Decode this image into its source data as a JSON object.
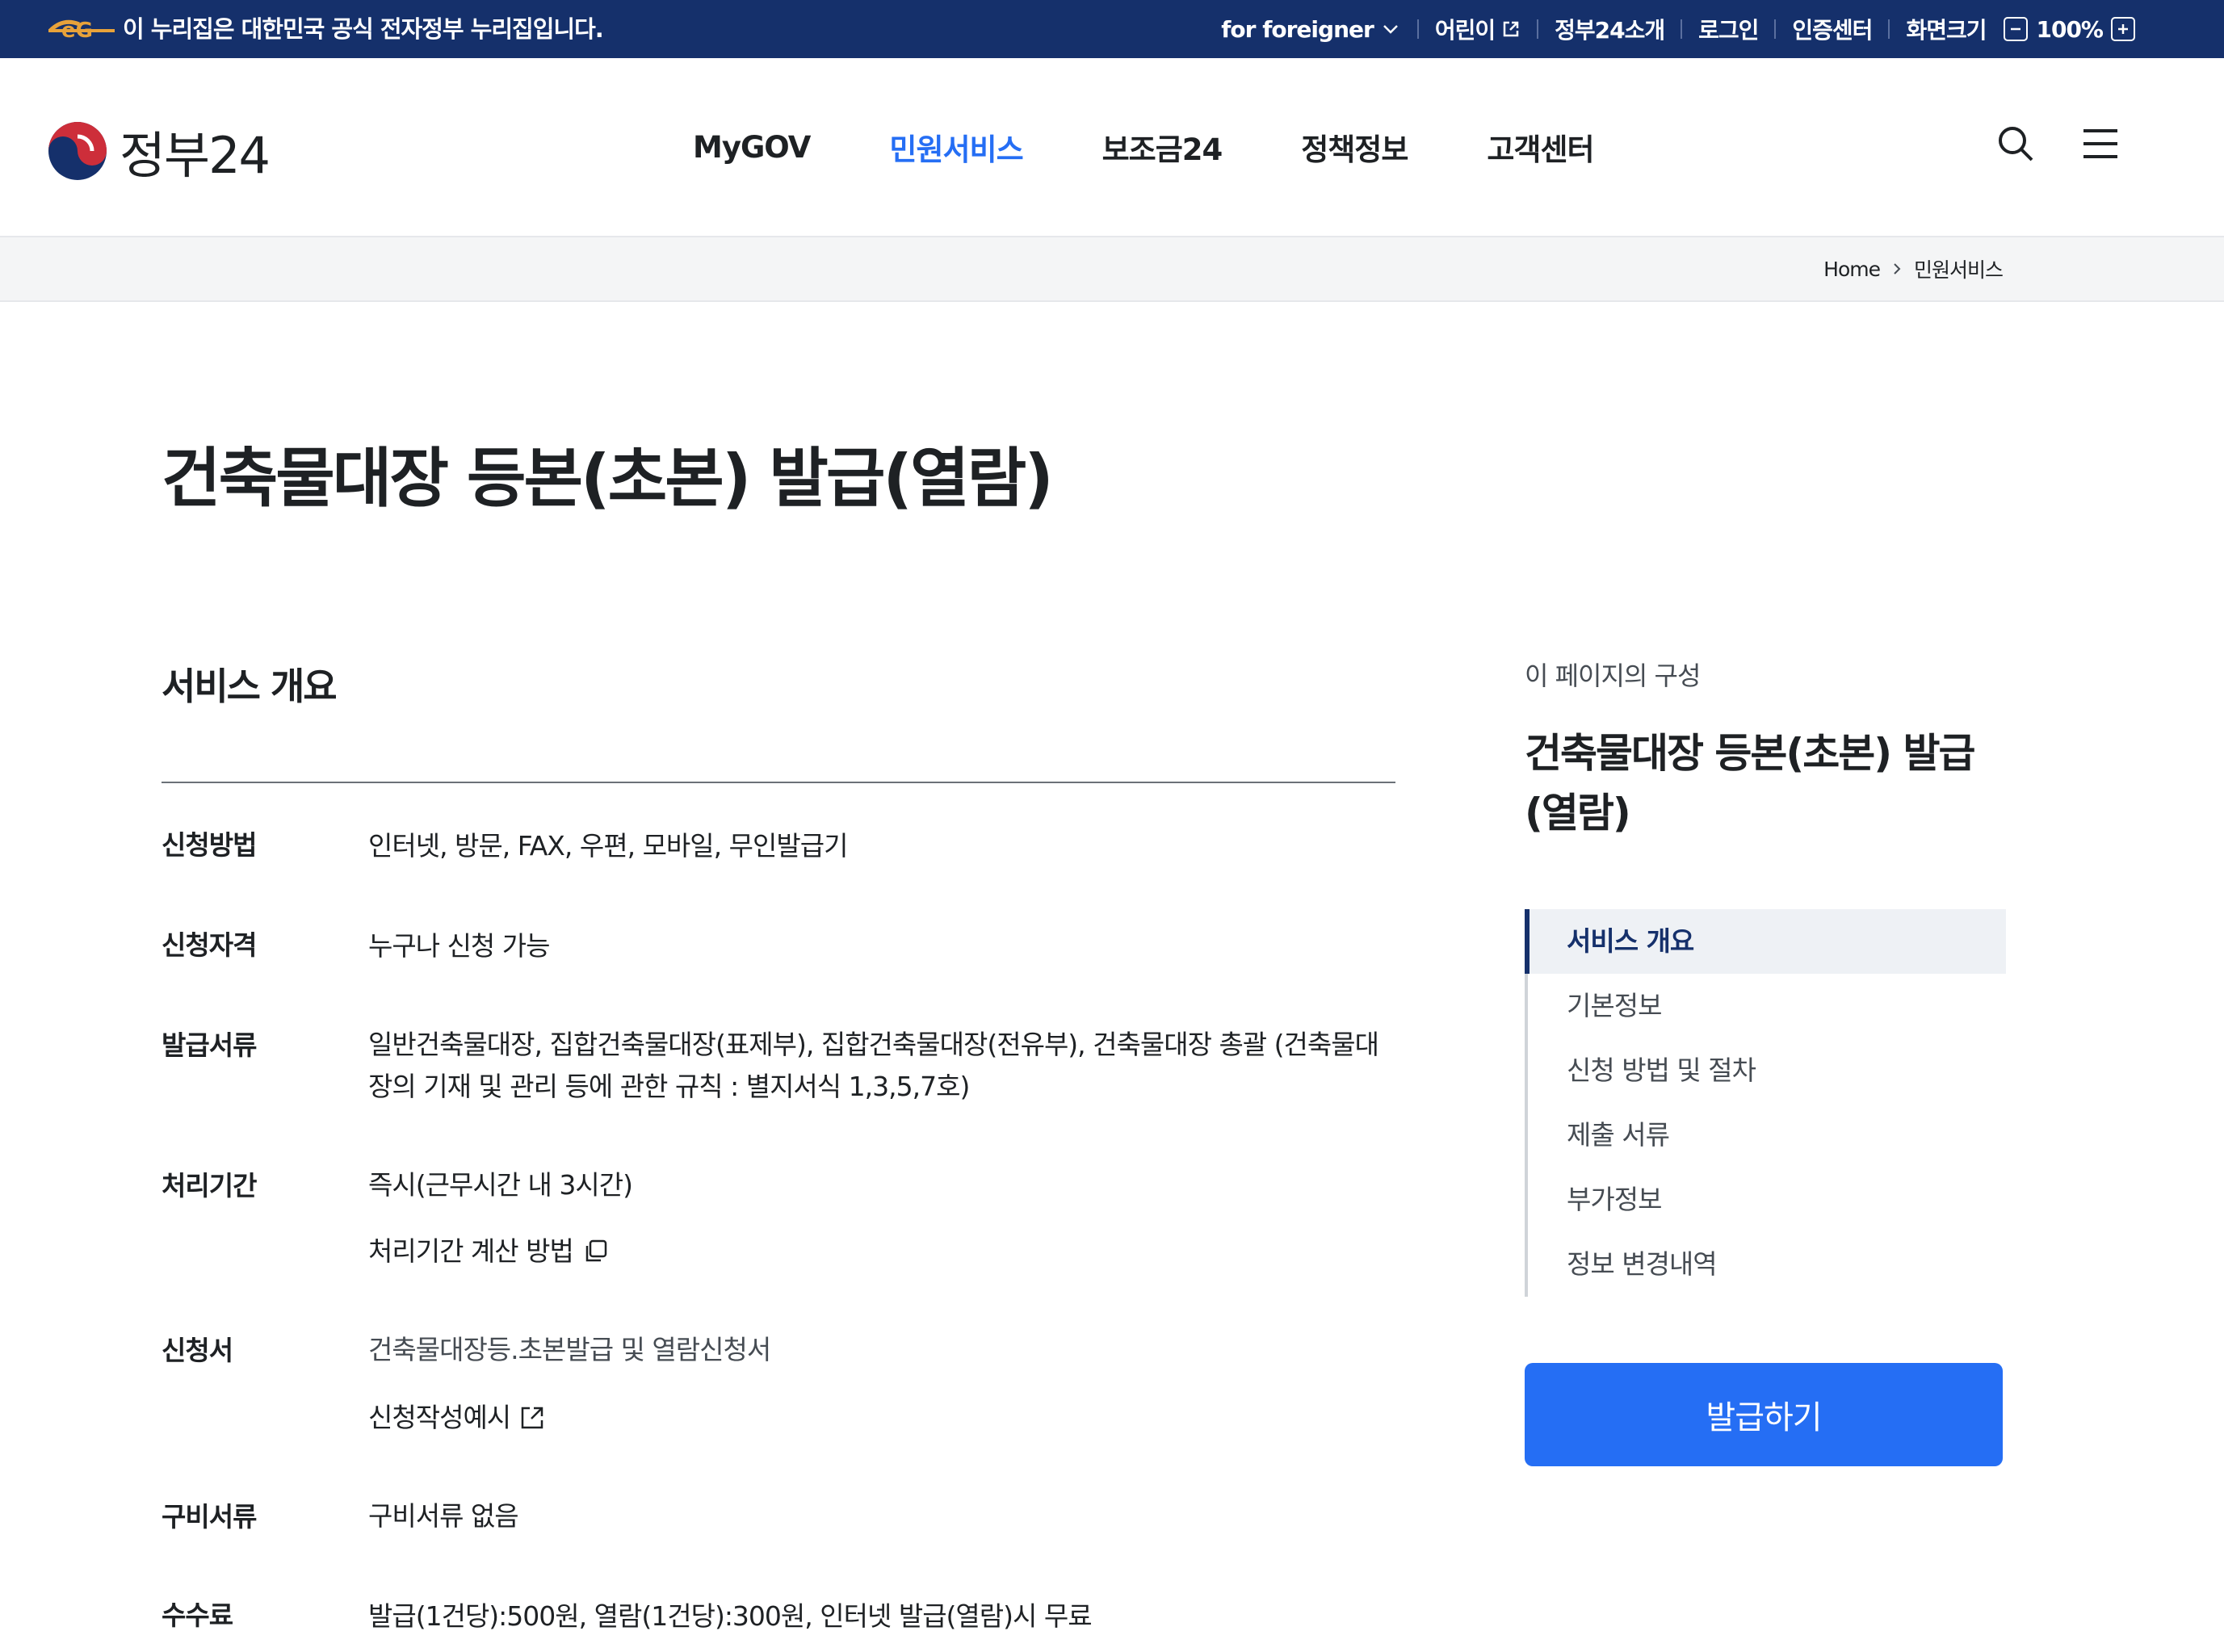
{
  "gov_bar": {
    "notice": "이 누리집은 대한민국 공식 전자정부 누리집입니다.",
    "links": [
      "for foreigner",
      "어린이",
      "정부24소개",
      "로그인",
      "인증센터",
      "화면크기"
    ],
    "zoom": "100%"
  },
  "header": {
    "brand": "정부24",
    "menus": [
      "MyGOV",
      "민원서비스",
      "보조금24",
      "정책정보",
      "고객센터"
    ],
    "active_menu": "민원서비스"
  },
  "breadcrumb": [
    "Home",
    "민원서비스"
  ],
  "page_title": "건축물대장 등본(초본) 발급(열람)",
  "section": {
    "title": "서비스 개요",
    "rows": [
      {
        "label": "신청방법",
        "values": [
          "인터넷, 방문, FAX, 우편, 모바일, 무인발급기"
        ]
      },
      {
        "label": "신청자격",
        "values": [
          "누구나 신청 가능"
        ]
      },
      {
        "label": "발급서류",
        "values": [
          "일반건축물대장, 집합건축물대장(표제부), 집합건축물대장(전유부), 건축물대장 총괄 (건축물대장의 기재 및 관리 등에 관한 규칙 : 별지서식 1,3,5,7호)"
        ]
      },
      {
        "label": "처리기간",
        "values": [
          "즉시(근무시간 내 3시간)",
          "처리기간 계산 방법"
        ]
      },
      {
        "label": "신청서",
        "values": [
          "건축물대장등.초본발급 및 열람신청서",
          "신청작성예시"
        ]
      },
      {
        "label": "구비서류",
        "values": [
          "구비서류 없음"
        ]
      },
      {
        "label": "수수료",
        "values": [
          "발급(1건당):500원, 열람(1건당):300원, 인터넷 발급(열람)시 무료"
        ]
      }
    ]
  },
  "side": {
    "caption": "이 페이지의 구성",
    "title": "건축물대장 등본(초본) 발급(열람)",
    "toc": [
      "서비스 개요",
      "기본정보",
      "신청 방법 및 절차",
      "제출 서류",
      "부가정보",
      "정보 변경내역"
    ],
    "active_toc": "서비스 개요",
    "button": "발급하기"
  },
  "colors": {
    "gov_bar": "#15306b",
    "accent": "#256ef4",
    "navy": "#15306b"
  }
}
